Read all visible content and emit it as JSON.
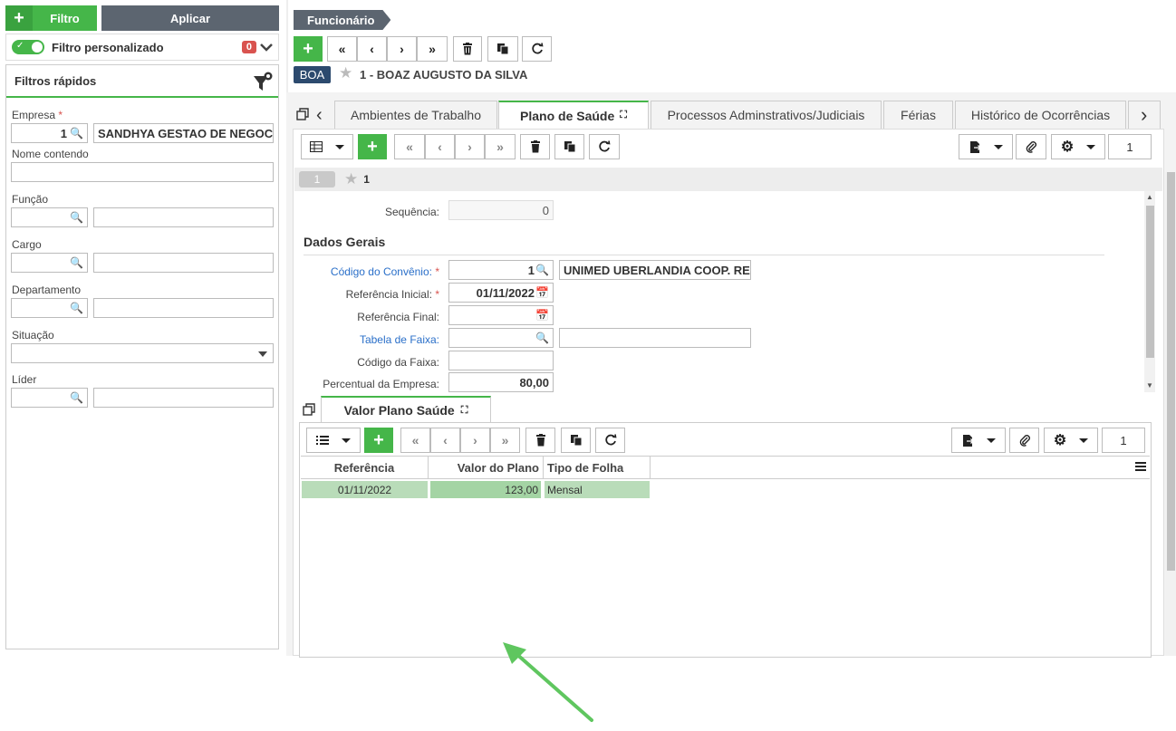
{
  "left_panel": {
    "filtro_label": "Filtro",
    "aplicar_label": "Aplicar",
    "filtro_personalizado": "Filtro personalizado",
    "filtro_count": "0",
    "filtros_rapidos": "Filtros rápidos",
    "empresa": {
      "label": "Empresa",
      "code": "1",
      "desc": "SANDHYA GESTAO DE NEGOCIOS"
    },
    "nome_contendo": "Nome contendo",
    "funcao": "Função",
    "cargo": "Cargo",
    "departamento": "Departamento",
    "situacao": "Situação",
    "lider": "Líder"
  },
  "header": {
    "breadcrumb": "Funcionário",
    "tag": "BOA",
    "employee": "1 - BOAZ AUGUSTO DA SILVA"
  },
  "tabs": [
    "Ambientes de Trabalho",
    "Plano de Saúde",
    "Processos Adminstrativos/Judiciais",
    "Férias",
    "Histórico de Ocorrências"
  ],
  "plano": {
    "page_number": "1",
    "record_pill": "1",
    "record_num": "1",
    "sequencia_label": "Sequência:",
    "sequencia_value": "0",
    "section": "Dados Gerais",
    "codigo_convenio_label": "Código do Convênio:",
    "codigo_convenio_value": "1",
    "codigo_convenio_desc": "UNIMED UBERLANDIA COOP. RE",
    "ref_inicial_label": "Referência Inicial:",
    "ref_inicial_value": "01/11/2022",
    "ref_final_label": "Referência Final:",
    "tabela_faixa_label": "Tabela de Faixa:",
    "codigo_faixa_label": "Código da Faixa:",
    "percentual_label": "Percentual da Empresa:",
    "percentual_value": "80,00"
  },
  "valor_plano": {
    "tab": "Valor Plano Saúde",
    "page_number": "1",
    "columns": [
      "Referência",
      "Valor do Plano",
      "Tipo de Folha"
    ],
    "rows": [
      {
        "referencia": "01/11/2022",
        "valor": "123,00",
        "tipo": "Mensal"
      }
    ]
  },
  "colors": {
    "green": "#45b649",
    "dark_grey": "#5c6570",
    "arrow": "#5fc65f"
  }
}
